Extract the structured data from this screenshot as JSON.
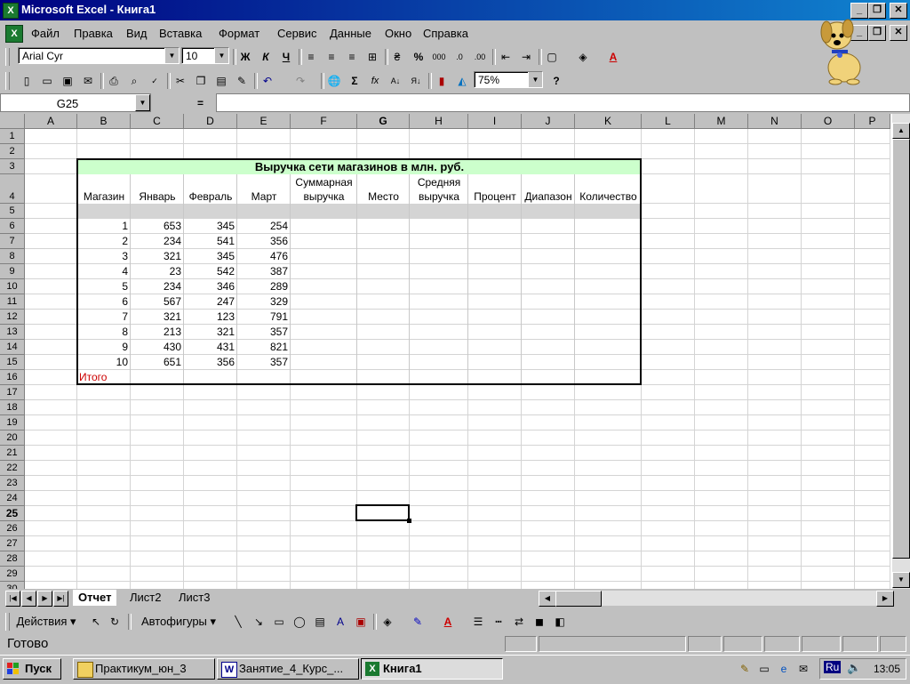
{
  "window": {
    "title": "Microsoft Excel - Книга1"
  },
  "menu": [
    "Файл",
    "Правка",
    "Вид",
    "Вставка",
    "Формат",
    "Сервис",
    "Данные",
    "Окно",
    "Справка"
  ],
  "format_toolbar": {
    "font": "Arial Cyr",
    "size": "10",
    "bold": "Ж",
    "italic": "К",
    "underline": "Ч",
    "percent": "%",
    "thousands": "000"
  },
  "standard_toolbar": {
    "zoom": "75%",
    "sum": "Σ",
    "fx": "fx"
  },
  "formula_bar": {
    "name_box": "G25",
    "equals": "=",
    "formula": ""
  },
  "columns": [
    "A",
    "B",
    "C",
    "D",
    "E",
    "F",
    "G",
    "H",
    "I",
    "J",
    "K",
    "L",
    "M",
    "N",
    "O",
    "P"
  ],
  "rows": [
    "1",
    "2",
    "3",
    "4",
    "5",
    "6",
    "7",
    "8",
    "9",
    "10",
    "11",
    "12",
    "13",
    "14",
    "15",
    "16",
    "17",
    "18",
    "19",
    "20",
    "21",
    "22",
    "23",
    "24",
    "25",
    "26",
    "27",
    "28",
    "29",
    "30"
  ],
  "selected": {
    "col": "G",
    "row": "25"
  },
  "table": {
    "title": "Выручка сети магазинов в млн. руб.",
    "headers": [
      {
        "line1": "",
        "line2": "Магазин"
      },
      {
        "line1": "",
        "line2": "Январь"
      },
      {
        "line1": "",
        "line2": "Февраль"
      },
      {
        "line1": "",
        "line2": "Март"
      },
      {
        "line1": "Суммарная",
        "line2": "выручка"
      },
      {
        "line1": "",
        "line2": "Место"
      },
      {
        "line1": "Средняя",
        "line2": "выручка"
      },
      {
        "line1": "",
        "line2": "Процент"
      },
      {
        "line1": "",
        "line2": "Диапазон"
      },
      {
        "line1": "",
        "line2": "Количество"
      }
    ],
    "data": [
      [
        "1",
        "653",
        "345",
        "254"
      ],
      [
        "2",
        "234",
        "541",
        "356"
      ],
      [
        "3",
        "321",
        "345",
        "476"
      ],
      [
        "4",
        "23",
        "542",
        "387"
      ],
      [
        "5",
        "234",
        "346",
        "289"
      ],
      [
        "6",
        "567",
        "247",
        "329"
      ],
      [
        "7",
        "321",
        "123",
        "791"
      ],
      [
        "8",
        "213",
        "321",
        "357"
      ],
      [
        "9",
        "430",
        "431",
        "821"
      ],
      [
        "10",
        "651",
        "356",
        "357"
      ]
    ],
    "total_label": "Итого"
  },
  "sheets": {
    "tabs": [
      "Отчет",
      "Лист2",
      "Лист3"
    ],
    "active": "Отчет"
  },
  "draw_toolbar": {
    "actions": "Действия",
    "autoshapes": "Автофигуры"
  },
  "status": {
    "text": "Готово"
  },
  "taskbar": {
    "start": "Пуск",
    "tasks": [
      {
        "label": "Практикум_юн_3",
        "icon": "folder-icon"
      },
      {
        "label": "Занятие_4_Курс_...",
        "icon": "word-icon"
      },
      {
        "label": "Книга1",
        "icon": "excel-icon"
      }
    ],
    "lang": "Ru",
    "clock": "13:05"
  },
  "colors": {
    "title_green": "#ccffcc",
    "gray_row": "#d4d4d4",
    "total_red": "#cc0000",
    "titlebar": "#000080"
  }
}
